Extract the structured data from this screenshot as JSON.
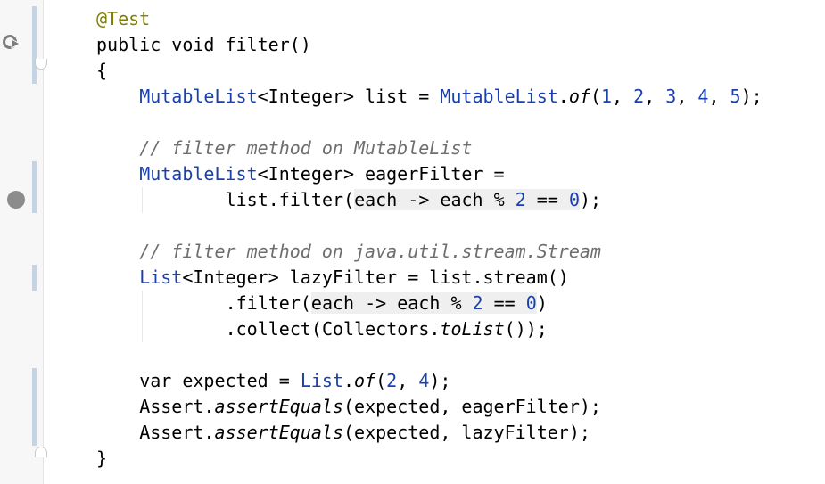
{
  "editor": {
    "lines": [
      {
        "n": 1,
        "indent": 0,
        "tokens": [
          {
            "t": "@Test",
            "c": "annotation"
          }
        ]
      },
      {
        "n": 2,
        "indent": 0,
        "tokens": [
          {
            "t": "public void filter()",
            "c": "plain"
          }
        ]
      },
      {
        "n": 3,
        "indent": 0,
        "tokens": [
          {
            "t": "{",
            "c": "plain"
          }
        ]
      },
      {
        "n": 4,
        "indent": 4,
        "tokens": [
          {
            "t": "MutableList",
            "c": "type"
          },
          {
            "t": "<Integer> list = ",
            "c": "plain"
          },
          {
            "t": "MutableList",
            "c": "type"
          },
          {
            "t": ".",
            "c": "plain"
          },
          {
            "t": "of",
            "c": "static"
          },
          {
            "t": "(",
            "c": "plain"
          },
          {
            "t": "1",
            "c": "num"
          },
          {
            "t": ", ",
            "c": "plain"
          },
          {
            "t": "2",
            "c": "num"
          },
          {
            "t": ", ",
            "c": "plain"
          },
          {
            "t": "3",
            "c": "num"
          },
          {
            "t": ", ",
            "c": "plain"
          },
          {
            "t": "4",
            "c": "num"
          },
          {
            "t": ", ",
            "c": "plain"
          },
          {
            "t": "5",
            "c": "num"
          },
          {
            "t": ");",
            "c": "plain"
          }
        ]
      },
      {
        "n": 5,
        "indent": 0,
        "tokens": []
      },
      {
        "n": 6,
        "indent": 4,
        "tokens": [
          {
            "t": "// filter method on MutableList",
            "c": "comment"
          }
        ]
      },
      {
        "n": 7,
        "indent": 4,
        "tokens": [
          {
            "t": "MutableList",
            "c": "type"
          },
          {
            "t": "<Integer> eagerFilter =",
            "c": "plain"
          }
        ]
      },
      {
        "n": 8,
        "indent": 12,
        "tokens": [
          {
            "t": "list.filter(",
            "c": "plain"
          },
          {
            "t": "each -> each % ",
            "c": "lambda"
          },
          {
            "t": "2",
            "c": "num-lambda"
          },
          {
            "t": " == ",
            "c": "lambda"
          },
          {
            "t": "0",
            "c": "num-lambda"
          },
          {
            "t": ");",
            "c": "plain"
          }
        ]
      },
      {
        "n": 9,
        "indent": 0,
        "tokens": []
      },
      {
        "n": 10,
        "indent": 4,
        "tokens": [
          {
            "t": "// filter method on java.util.stream.Stream",
            "c": "comment"
          }
        ]
      },
      {
        "n": 11,
        "indent": 4,
        "tokens": [
          {
            "t": "List",
            "c": "type"
          },
          {
            "t": "<Integer> lazyFilter = list.stream()",
            "c": "plain"
          }
        ]
      },
      {
        "n": 12,
        "indent": 12,
        "tokens": [
          {
            "t": ".filter(",
            "c": "plain"
          },
          {
            "t": "each -> each % ",
            "c": "lambda"
          },
          {
            "t": "2",
            "c": "num-lambda"
          },
          {
            "t": " == ",
            "c": "lambda"
          },
          {
            "t": "0",
            "c": "num-lambda"
          },
          {
            "t": ")",
            "c": "plain"
          }
        ]
      },
      {
        "n": 13,
        "indent": 12,
        "tokens": [
          {
            "t": ".collect(Collectors.",
            "c": "plain"
          },
          {
            "t": "toList",
            "c": "static"
          },
          {
            "t": "());",
            "c": "plain"
          }
        ]
      },
      {
        "n": 14,
        "indent": 0,
        "tokens": []
      },
      {
        "n": 15,
        "indent": 4,
        "tokens": [
          {
            "t": "var expected = ",
            "c": "plain"
          },
          {
            "t": "List",
            "c": "type"
          },
          {
            "t": ".",
            "c": "plain"
          },
          {
            "t": "of",
            "c": "static"
          },
          {
            "t": "(",
            "c": "plain"
          },
          {
            "t": "2",
            "c": "num"
          },
          {
            "t": ", ",
            "c": "plain"
          },
          {
            "t": "4",
            "c": "num"
          },
          {
            "t": ");",
            "c": "plain"
          }
        ]
      },
      {
        "n": 16,
        "indent": 4,
        "tokens": [
          {
            "t": "Assert.",
            "c": "plain"
          },
          {
            "t": "assertEquals",
            "c": "static"
          },
          {
            "t": "(expected, eagerFilter);",
            "c": "plain"
          }
        ]
      },
      {
        "n": 17,
        "indent": 4,
        "tokens": [
          {
            "t": "Assert.",
            "c": "plain"
          },
          {
            "t": "assertEquals",
            "c": "static"
          },
          {
            "t": "(expected, lazyFilter);",
            "c": "plain"
          }
        ]
      },
      {
        "n": 18,
        "indent": 0,
        "tokens": [
          {
            "t": "}",
            "c": "plain"
          }
        ]
      }
    ],
    "colors": {
      "type": "#1a40b0",
      "annotation": "#808000",
      "comment": "#6e6e6e",
      "lambda_bg": "#efefef",
      "breakpoint": "#8c8c8c"
    },
    "gutter": {
      "run_icon": "run-test-icon",
      "breakpoint_line": 8,
      "changed_lines": [
        1,
        2,
        3,
        7,
        8,
        11,
        15,
        16,
        17
      ]
    }
  }
}
